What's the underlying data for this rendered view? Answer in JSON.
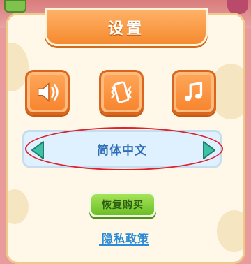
{
  "header": {
    "title": "设置"
  },
  "icons": {
    "sound": "speaker-icon",
    "vibrate": "vibrate-phone-icon",
    "music": "music-note-icon"
  },
  "language": {
    "selected": "简体中文",
    "prev": "left-arrow",
    "next": "right-arrow"
  },
  "buttons": {
    "restore_label": "恢复购买"
  },
  "links": {
    "privacy_label": "隐私政策"
  },
  "colors": {
    "panel_bg": "#fff8e8",
    "header_orange": "#f58a2f",
    "icon_orange": "#f7832c",
    "lang_bg": "#dff1ff",
    "lang_text": "#2f6fb5",
    "restore_green": "#6bbf25",
    "link_blue": "#2b8bd6",
    "arrow_teal": "#3fc1a8",
    "highlight_red": "#e0202a"
  }
}
